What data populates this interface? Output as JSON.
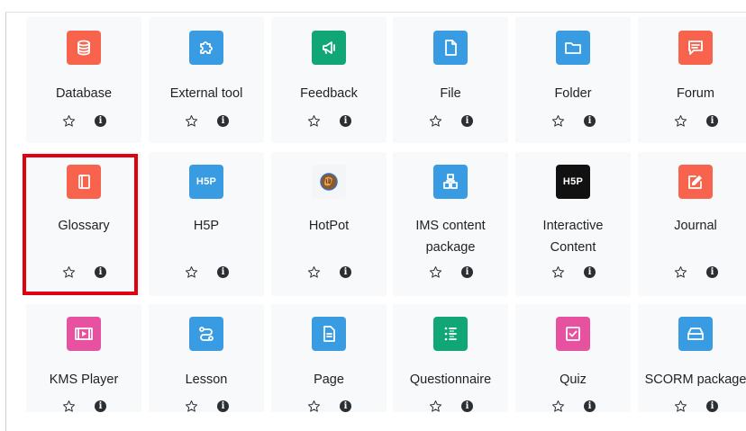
{
  "activities": [
    {
      "name": "Database",
      "icon": "database-icon",
      "color": "#f7634d",
      "lines": [
        "Database"
      ]
    },
    {
      "name": "External tool",
      "icon": "puzzle-icon",
      "color": "#399be2",
      "lines": [
        "External tool"
      ]
    },
    {
      "name": "Feedback",
      "icon": "megaphone-icon",
      "color": "#11a676",
      "lines": [
        "Feedback"
      ]
    },
    {
      "name": "File",
      "icon": "file-icon",
      "color": "#399be2",
      "lines": [
        "File"
      ]
    },
    {
      "name": "Folder",
      "icon": "folder-icon",
      "color": "#399be2",
      "lines": [
        "Folder"
      ]
    },
    {
      "name": "Forum",
      "icon": "forum-icon",
      "color": "#f7634d",
      "lines": [
        "Forum"
      ]
    },
    {
      "name": "Glossary",
      "icon": "glossary-book-icon",
      "color": "#f7634d",
      "lines": [
        "Glossary"
      ]
    },
    {
      "name": "H5P",
      "icon": "h5p-icon",
      "color": "#399be2",
      "lines": [
        "H5P"
      ],
      "badge": "H5P"
    },
    {
      "name": "HotPot",
      "icon": "hotpot-icon",
      "color": "#f4f5f7",
      "lines": [
        "HotPot"
      ]
    },
    {
      "name": "IMS content package",
      "icon": "package-icon",
      "color": "#399be2",
      "lines": [
        "IMS content",
        "package"
      ]
    },
    {
      "name": "Interactive Content",
      "icon": "h5p-dark-icon",
      "color": "#111111",
      "lines": [
        "Interactive",
        "Content"
      ],
      "badge": "H5P"
    },
    {
      "name": "Journal",
      "icon": "pencil-square-icon",
      "color": "#f7634d",
      "lines": [
        "Journal"
      ]
    },
    {
      "name": "KMS Player",
      "icon": "video-icon",
      "color": "#e651a0",
      "lines": [
        "KMS Player"
      ]
    },
    {
      "name": "Lesson",
      "icon": "lesson-path-icon",
      "color": "#399be2",
      "lines": [
        "Lesson"
      ]
    },
    {
      "name": "Page",
      "icon": "page-icon",
      "color": "#399be2",
      "lines": [
        "Page"
      ]
    },
    {
      "name": "Questionnaire",
      "icon": "checklist-icon",
      "color": "#11a676",
      "lines": [
        "Questionnaire"
      ]
    },
    {
      "name": "Quiz",
      "icon": "quiz-check-icon",
      "color": "#e651a0",
      "lines": [
        "Quiz"
      ]
    },
    {
      "name": "SCORM package",
      "icon": "scorm-box-icon",
      "color": "#399be2",
      "lines": [
        "SCORM package"
      ]
    }
  ],
  "info_glyph": "i",
  "highlighted": "Glossary"
}
